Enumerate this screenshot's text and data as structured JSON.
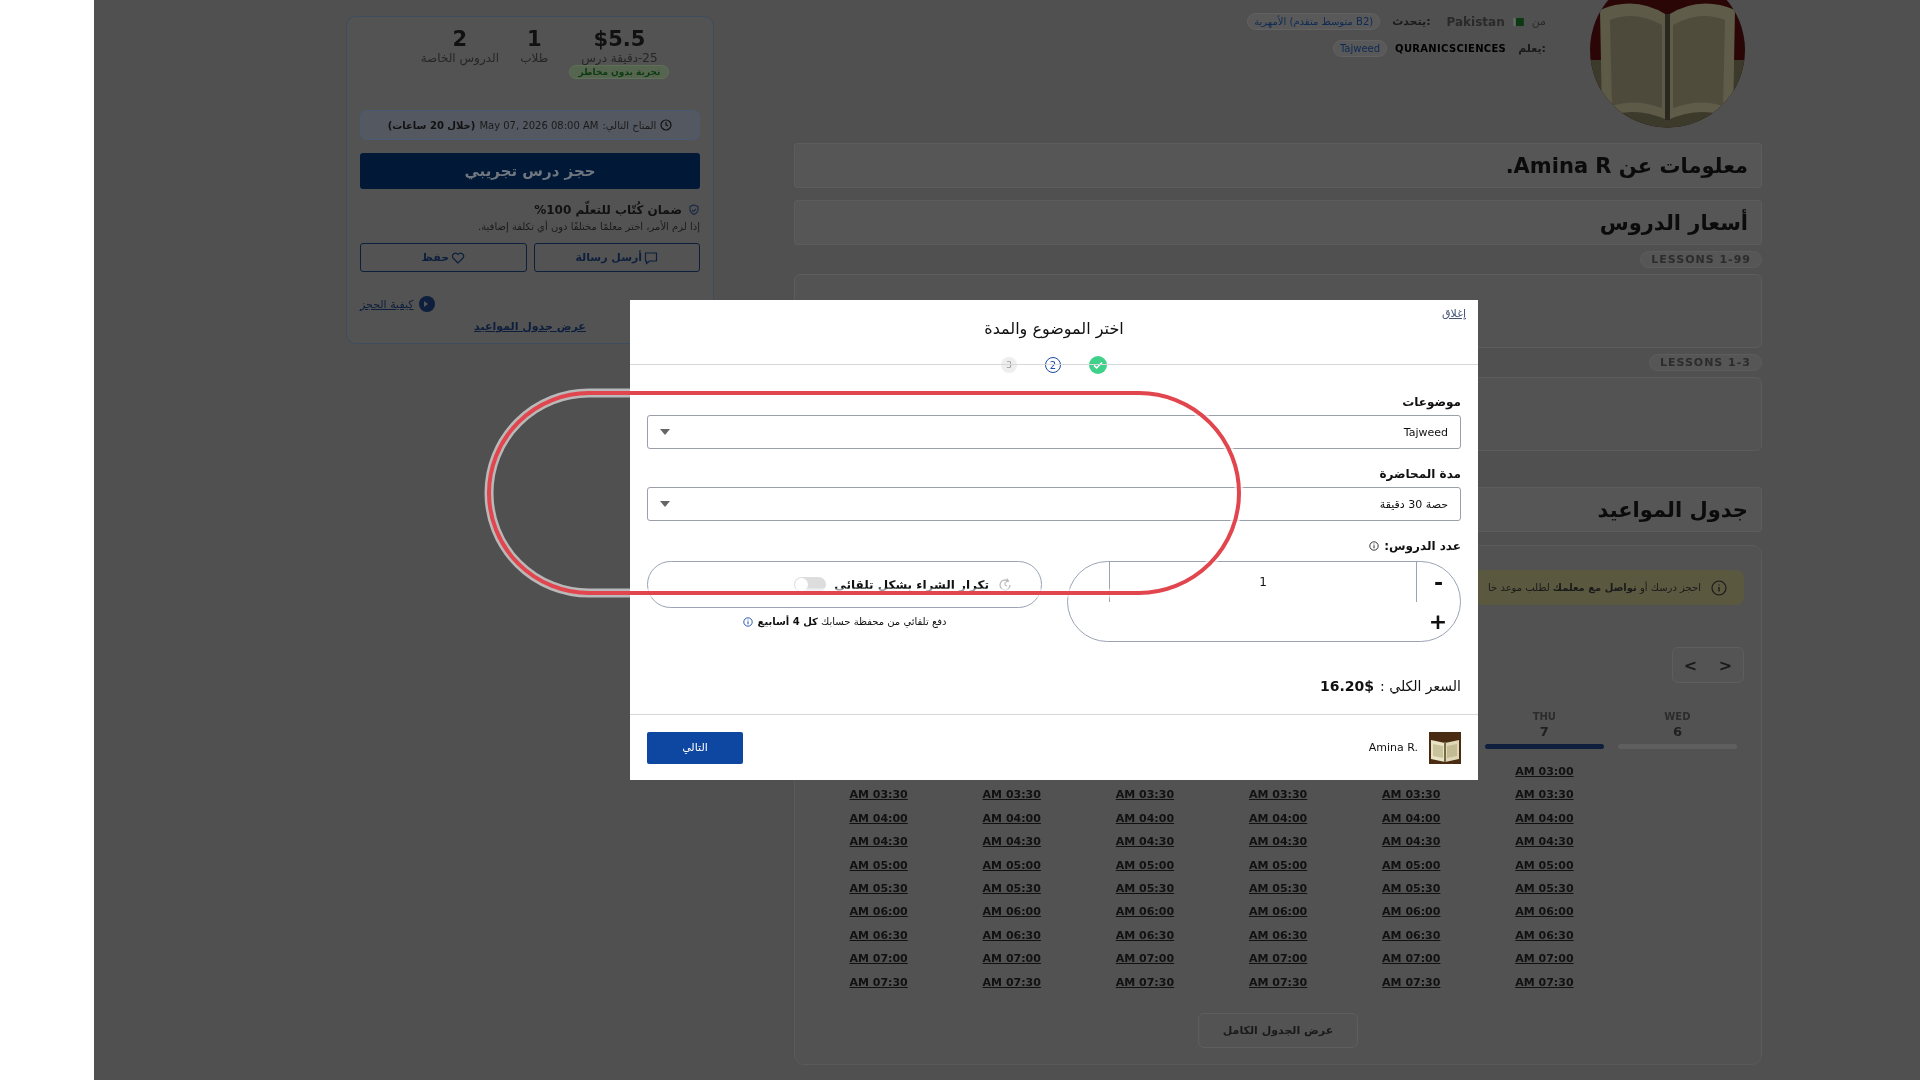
{
  "trial_card": {
    "stats": [
      {
        "value": "$5.5",
        "label": "25-دقيقة درس",
        "badge": "تجربة بدون مخاطر"
      },
      {
        "value": "1",
        "label": "طلاب"
      },
      {
        "value": "2",
        "label": "الدروس الخاصة"
      }
    ],
    "next_slot": {
      "label": "المتاح التالي:",
      "time": "May 07, 2026 08:00 AM",
      "relative": "(خلال 20 ساعات)"
    },
    "book_button": "حجز درس تجريبي",
    "guarantee": {
      "title": "ضمان كُتّاب للتعلّم 100%",
      "text": "إذا لزم الأمر، اختر معلمًا مختلفًا دون أي تكلفة إضافية."
    },
    "buttons": [
      {
        "kind": "message",
        "label": "أرسل رسالة"
      },
      {
        "kind": "save",
        "label": "حفظ"
      }
    ],
    "how_to_book": "كيفية الحجز",
    "view_schedule": "عرض جدول المواعيد"
  },
  "tutor": {
    "from_label": "من",
    "country": "Pakistan",
    "speaks_label": "يتحدث:",
    "languages": [
      "الأمهرية (متوسط متقدم B2)"
    ],
    "teaches_label": "يعلم:",
    "category": "QURANICSCIENCES",
    "subjects": [
      "Tajweed"
    ]
  },
  "sections": {
    "about": "معلومات عن Amina R.",
    "prices": "أسعار الدروس",
    "schedule": "جدول المواعيد"
  },
  "price_tiers": [
    "LESSONS 1-99",
    "LESSONS 1-3"
  ],
  "schedule": {
    "notice": "احجز درسك أو **تواصل مع معلمك** لطلب موعد خا",
    "days": [
      {
        "day": "WED",
        "date": "6",
        "selected": false
      },
      {
        "day": "THU",
        "date": "7",
        "selected": true
      }
    ],
    "slot_columns": [
      [
        "AM 03:00",
        "AM 03:30",
        "AM 04:00",
        "AM 04:30",
        "AM 05:00",
        "AM 05:30",
        "AM 06:00",
        "AM 06:30",
        "AM 07:00",
        "AM 07:30"
      ],
      [
        "AM 03:30",
        "AM 04:00",
        "AM 04:30",
        "AM 05:00",
        "AM 05:30",
        "AM 06:00",
        "AM 06:30",
        "AM 07:00",
        "AM 07:30"
      ],
      [
        "AM 03:30",
        "AM 04:00",
        "AM 04:30",
        "AM 05:00",
        "AM 05:30",
        "AM 06:00",
        "AM 06:30",
        "AM 07:00",
        "AM 07:30"
      ],
      [
        "AM 03:30",
        "AM 04:00",
        "AM 04:30",
        "AM 05:00",
        "AM 05:30",
        "AM 06:00",
        "AM 06:30",
        "AM 07:00",
        "AM 07:30"
      ],
      [
        "AM 03:30",
        "AM 04:00",
        "AM 04:30",
        "AM 05:00",
        "AM 05:30",
        "AM 06:00",
        "AM 06:30",
        "AM 07:00",
        "AM 07:30"
      ],
      [
        "AM 03:30",
        "AM 04:00",
        "AM 04:30",
        "AM 05:00",
        "AM 05:30",
        "AM 06:00",
        "AM 06:30",
        "AM 07:00",
        "AM 07:30"
      ]
    ],
    "nav": [
      ">",
      "<"
    ],
    "full_button": "عرض الجدول الكامل"
  },
  "modal": {
    "close": "إغلاق",
    "title": "اختر الموضوع والمدة",
    "steps": [
      {
        "kind": "done"
      },
      {
        "kind": "current",
        "label": "2"
      },
      {
        "kind": "pending",
        "label": "3"
      }
    ],
    "subject": {
      "label": "موضوعات",
      "value": "Tajweed"
    },
    "duration": {
      "label": "مدة المحاضرة",
      "value": "حصة 30 دقيقة"
    },
    "count": {
      "label": "عدد الدروس:",
      "value": "1",
      "minus": "-",
      "plus": "+"
    },
    "auto_repeat": {
      "label": "تكرار الشراء بشكل تلقائي",
      "on": false,
      "note": "دفع تلقائي من محفظة حسابك **كل 4 أسابيع**"
    },
    "total": {
      "label": "السعر الكلي :",
      "value": "16.20$"
    },
    "tutor_name": "Amina R.",
    "next_button": "التالي"
  }
}
